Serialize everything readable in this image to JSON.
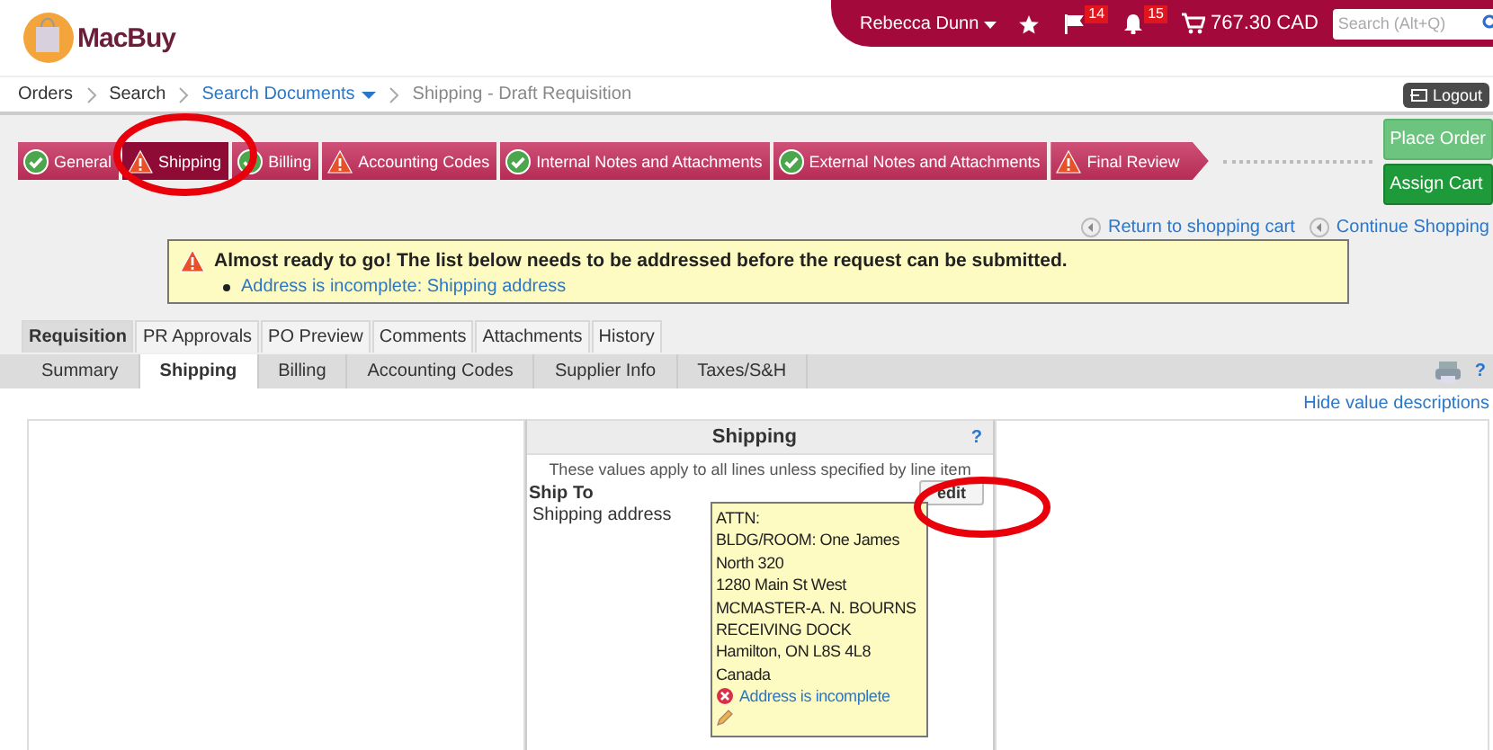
{
  "header": {
    "logo": "MacBuy",
    "user": "Rebecca Dunn",
    "flag_count": "14",
    "alert_count": "15",
    "cart_total": "767.30 CAD",
    "search": {
      "placeholder": "Search (Alt+Q)"
    }
  },
  "breadcrumb": [
    {
      "label": "Orders",
      "kind": "plain"
    },
    {
      "label": "Search",
      "kind": "plain"
    },
    {
      "label": "Search Documents",
      "kind": "menu"
    },
    {
      "label": "Shipping - Draft Requisition",
      "kind": "current"
    }
  ],
  "logout": "Logout",
  "steps": [
    {
      "label": "General",
      "complete": true,
      "selected": false
    },
    {
      "label": "Shipping",
      "complete": false,
      "selected": true
    },
    {
      "label": "Billing",
      "complete": true,
      "selected": false
    },
    {
      "label": "Accounting Codes",
      "complete": false,
      "selected": false
    },
    {
      "label": "Internal Notes and Attachments",
      "complete": true,
      "selected": false
    },
    {
      "label": "External Notes and Attachments",
      "complete": true,
      "selected": false
    },
    {
      "label": "Final Review",
      "complete": false,
      "selected": false
    }
  ],
  "actions": [
    {
      "label": "Place Order",
      "disabled": true
    },
    {
      "label": "Assign Cart",
      "disabled": false
    }
  ],
  "nav_links": [
    "Return to shopping cart",
    "Continue Shopping"
  ],
  "alert": {
    "message": "Almost ready to go! The list below needs to be addressed before the request can be submitted.",
    "items": [
      "Address is incomplete: Shipping address"
    ]
  },
  "tabs": [
    {
      "label": "Requisition",
      "selected": true
    },
    {
      "label": "PR Approvals",
      "selected": false
    },
    {
      "label": "PO Preview",
      "selected": false
    },
    {
      "label": "Comments",
      "selected": false
    },
    {
      "label": "Attachments",
      "selected": false
    },
    {
      "label": "History",
      "selected": false
    }
  ],
  "subtabs": [
    {
      "label": "Summary",
      "selected": false
    },
    {
      "label": "Shipping",
      "selected": true
    },
    {
      "label": "Billing",
      "selected": false
    },
    {
      "label": "Accounting Codes",
      "selected": false
    },
    {
      "label": "Supplier Info",
      "selected": false
    },
    {
      "label": "Taxes/S&H",
      "selected": false
    }
  ],
  "subtab_help": "?",
  "hide_link": "Hide value descriptions",
  "shipping_panel": {
    "title": "Shipping",
    "help": "?",
    "note": "These values apply to all lines unless specified by line item",
    "section": "Ship To",
    "edit": "edit",
    "field_label": "Shipping address",
    "address_lines": [
      "ATTN:",
      "BLDG/ROOM: One James North 320",
      "1280 Main St West",
      "MCMASTER-A. N. BOURNS RECEIVING DOCK",
      "Hamilton, ON L8S 4L8",
      "Canada"
    ],
    "error": "Address is incomplete"
  }
}
